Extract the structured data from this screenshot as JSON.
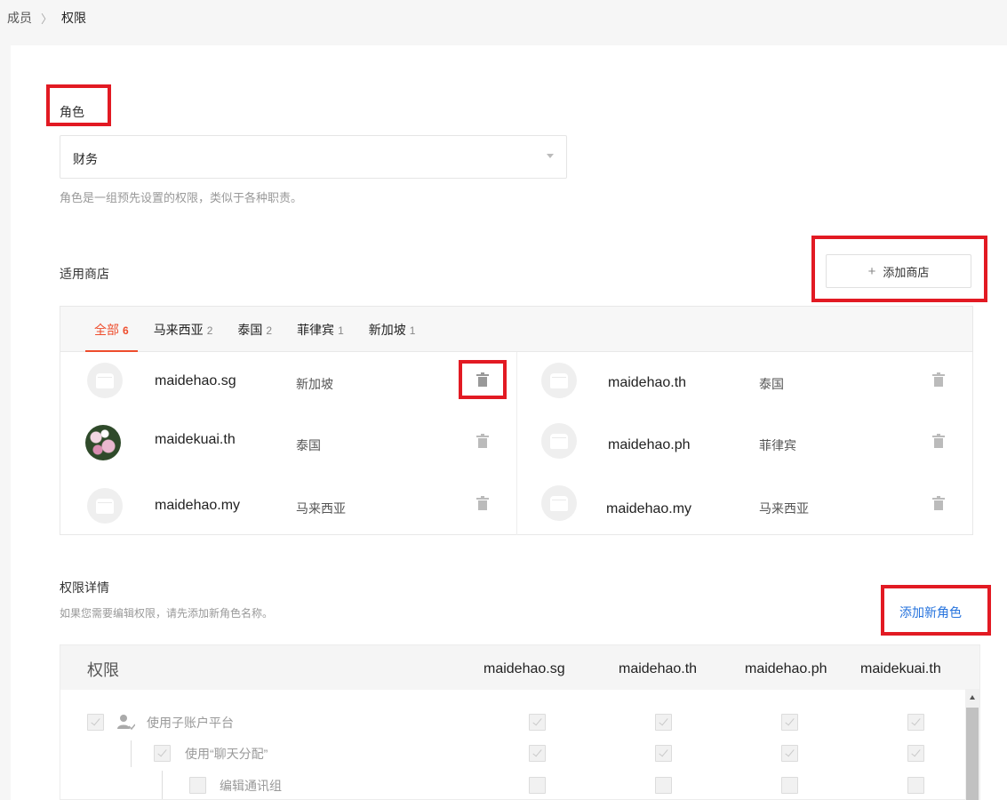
{
  "breadcrumb": {
    "parent": "成员",
    "separator": "〉",
    "current": "权限"
  },
  "role": {
    "label": "角色",
    "selected": "财务",
    "hint": "角色是一组预先设置的权限，类似于各种职责。"
  },
  "shops": {
    "label": "适用商店",
    "add_button": "添加商店",
    "add_button_icon": "+",
    "tabs": [
      {
        "label": "全部",
        "count": "6",
        "active": true
      },
      {
        "label": "马来西亚",
        "count": "2"
      },
      {
        "label": "泰国",
        "count": "2"
      },
      {
        "label": "菲律宾",
        "count": "1"
      },
      {
        "label": "新加坡",
        "count": "1"
      }
    ],
    "items": [
      {
        "name": "maidehao.sg",
        "region": "新加坡",
        "avatar": "store-icon"
      },
      {
        "name": "maidehao.th",
        "region": "泰国",
        "avatar": "store-icon"
      },
      {
        "name": "maidekuai.th",
        "region": "泰国",
        "avatar": "flower-photo"
      },
      {
        "name": "maidehao.ph",
        "region": "菲律宾",
        "avatar": "store-icon"
      },
      {
        "name": "maidehao.my",
        "region": "马来西亚",
        "avatar": "store-icon"
      },
      {
        "name": "maidehao.my",
        "region": "马来西亚",
        "avatar": "store-icon"
      }
    ]
  },
  "permissions": {
    "title": "权限详情",
    "hint": "如果您需要编辑权限，请先添加新角色名称。",
    "add_role_link": "添加新角色",
    "columns": [
      "权限",
      "maidehao.sg",
      "maidehao.th",
      "maidehao.ph",
      "maidekuai.th"
    ],
    "rows": [
      {
        "label": "使用子账户平台",
        "checked": true,
        "icon": "user-icon"
      },
      {
        "label": "使用“聊天分配”",
        "checked": true
      },
      {
        "label": "编辑通讯组",
        "checked": false
      }
    ]
  },
  "colors": {
    "accent": "#ee4d2d",
    "link": "#2673dd",
    "annotation": "#e21a23"
  }
}
